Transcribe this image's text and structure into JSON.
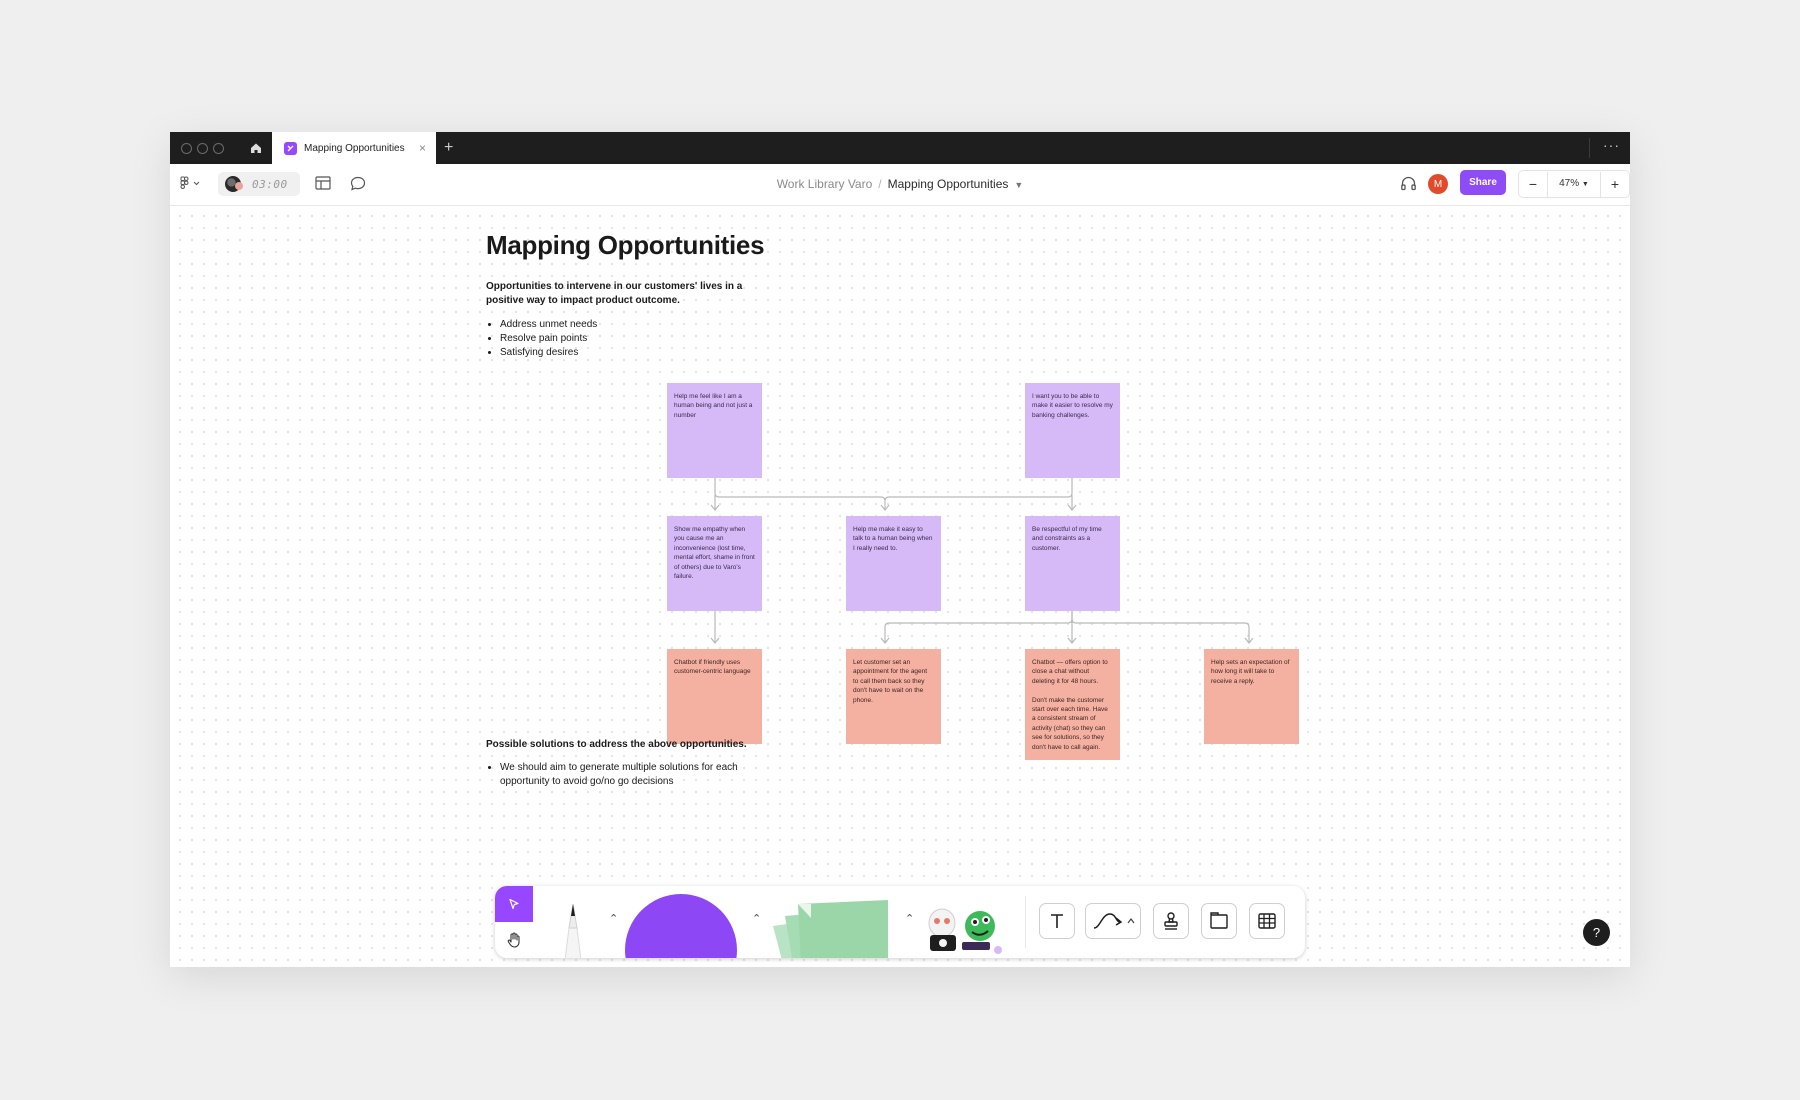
{
  "window": {
    "tab_title": "Mapping Opportunities",
    "tab_close": "×",
    "new_tab": "+",
    "more": "···"
  },
  "toolbar": {
    "timer": "03:00",
    "breadcrumb": {
      "team": "Work Library Varo",
      "separator": "/",
      "file": "Mapping Opportunities"
    },
    "avatar_initial": "M",
    "share_label": "Share",
    "zoom_out": "−",
    "zoom_level": "47%",
    "zoom_in": "+"
  },
  "doc": {
    "title": "Mapping Opportunities",
    "subtitle": "Opportunities to intervene in our customers' lives in a positive way to impact product outcome.",
    "bullets": [
      "Address unmet needs",
      "Resolve pain points",
      "Satisfying desires"
    ],
    "solutions_heading": "Possible solutions to address the above opportunities.",
    "solutions_bullets": [
      "We should aim to generate multiple solutions for each opportunity to avoid go/no go decisions"
    ]
  },
  "stickies": {
    "row1": [
      "Help me feel like I am a human being and not just a number",
      "I want you to be able to make it easier to resolve my banking challenges."
    ],
    "row2": [
      "Show me empathy when you cause me an inconvenience (lost time, mental effort, shame in front of others) due to Varo's failure.",
      "Help me make it easy to talk to a human being when I really need to.",
      "Be respectful of my time and constraints as a customer."
    ],
    "row3": [
      "Chatbot if friendly uses customer-centric language",
      "Let customer set an appointment for the agent to call them back so they don't have to wait on the phone.",
      "Chatbot — offers option to close a chat without deleting it for 48 hours.\n\nDon't make the customer start over each time. Have a consistent stream of activity (chat) so they can see for solutions, so they don't have to call again.",
      "Help sets an expectation of how long it will take to receive a reply."
    ]
  },
  "colors": {
    "sticky_purple": "#d6baf8",
    "sticky_salmon": "#f4b1a2",
    "accent": "#9747ff",
    "share": "#8d4cf6",
    "avatar": "#e14b2b"
  },
  "icons": [
    "home-icon",
    "figma-menu-icon",
    "layout-icon",
    "comment-icon",
    "headphones-icon",
    "move-icon",
    "hand-icon",
    "pencil-icon",
    "text-icon",
    "connector-icon",
    "stamp-icon",
    "section-icon",
    "table-icon"
  ],
  "help": "?"
}
